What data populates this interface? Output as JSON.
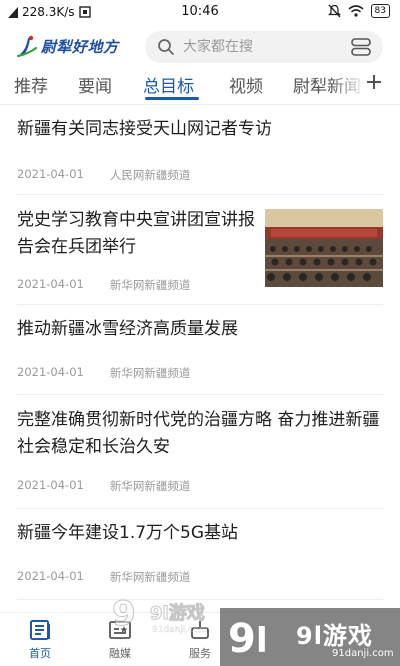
{
  "status_bar": {
    "network_speed": "228.3K/s",
    "time": "10:46",
    "battery": "83",
    "icons": [
      "sim-icon",
      "mute-icon",
      "wifi-icon",
      "signal-icon",
      "battery-icon"
    ]
  },
  "header": {
    "logo_text": "尉犁好地方",
    "search_placeholder": "大家都在搜"
  },
  "tabs": [
    {
      "label": "推荐",
      "active": false
    },
    {
      "label": "要闻",
      "active": false
    },
    {
      "label": "总目标",
      "active": true
    },
    {
      "label": "视频",
      "active": false
    },
    {
      "label": "尉犁新闻",
      "active": false
    }
  ],
  "news": [
    {
      "title": "新疆有关同志接受天山网记者专访",
      "date": "2021-04-01",
      "source": "人民网新疆频道"
    },
    {
      "title": "党史学习教育中央宣讲团宣讲报告会在兵团举行",
      "date": "2021-04-01",
      "source": "新华网新疆频道",
      "has_image": true
    },
    {
      "title": "推动新疆冰雪经济高质量发展",
      "date": "2021-04-01",
      "source": "新华网新疆频道"
    },
    {
      "title": "完整准确贯彻新时代党的治疆方略 奋力推进新疆社会稳定和长治久安",
      "date": "2021-04-01",
      "source": "新华网新疆频道"
    },
    {
      "title": "新疆今年建设1.7万个5G基站",
      "date": "2021-04-01",
      "source": "新华网新疆频道"
    }
  ],
  "bottom_nav": [
    {
      "label": "首页",
      "icon": "home-icon",
      "active": true
    },
    {
      "label": "融媒",
      "icon": "media-icon",
      "active": false
    },
    {
      "label": "服务",
      "icon": "service-icon",
      "active": false
    }
  ],
  "watermark": {
    "text": "9l游戏",
    "url": "91danji.com"
  },
  "colors": {
    "accent": "#1a5aa8",
    "logo": "#1d4fa3",
    "meta": "#9a9a9a"
  }
}
